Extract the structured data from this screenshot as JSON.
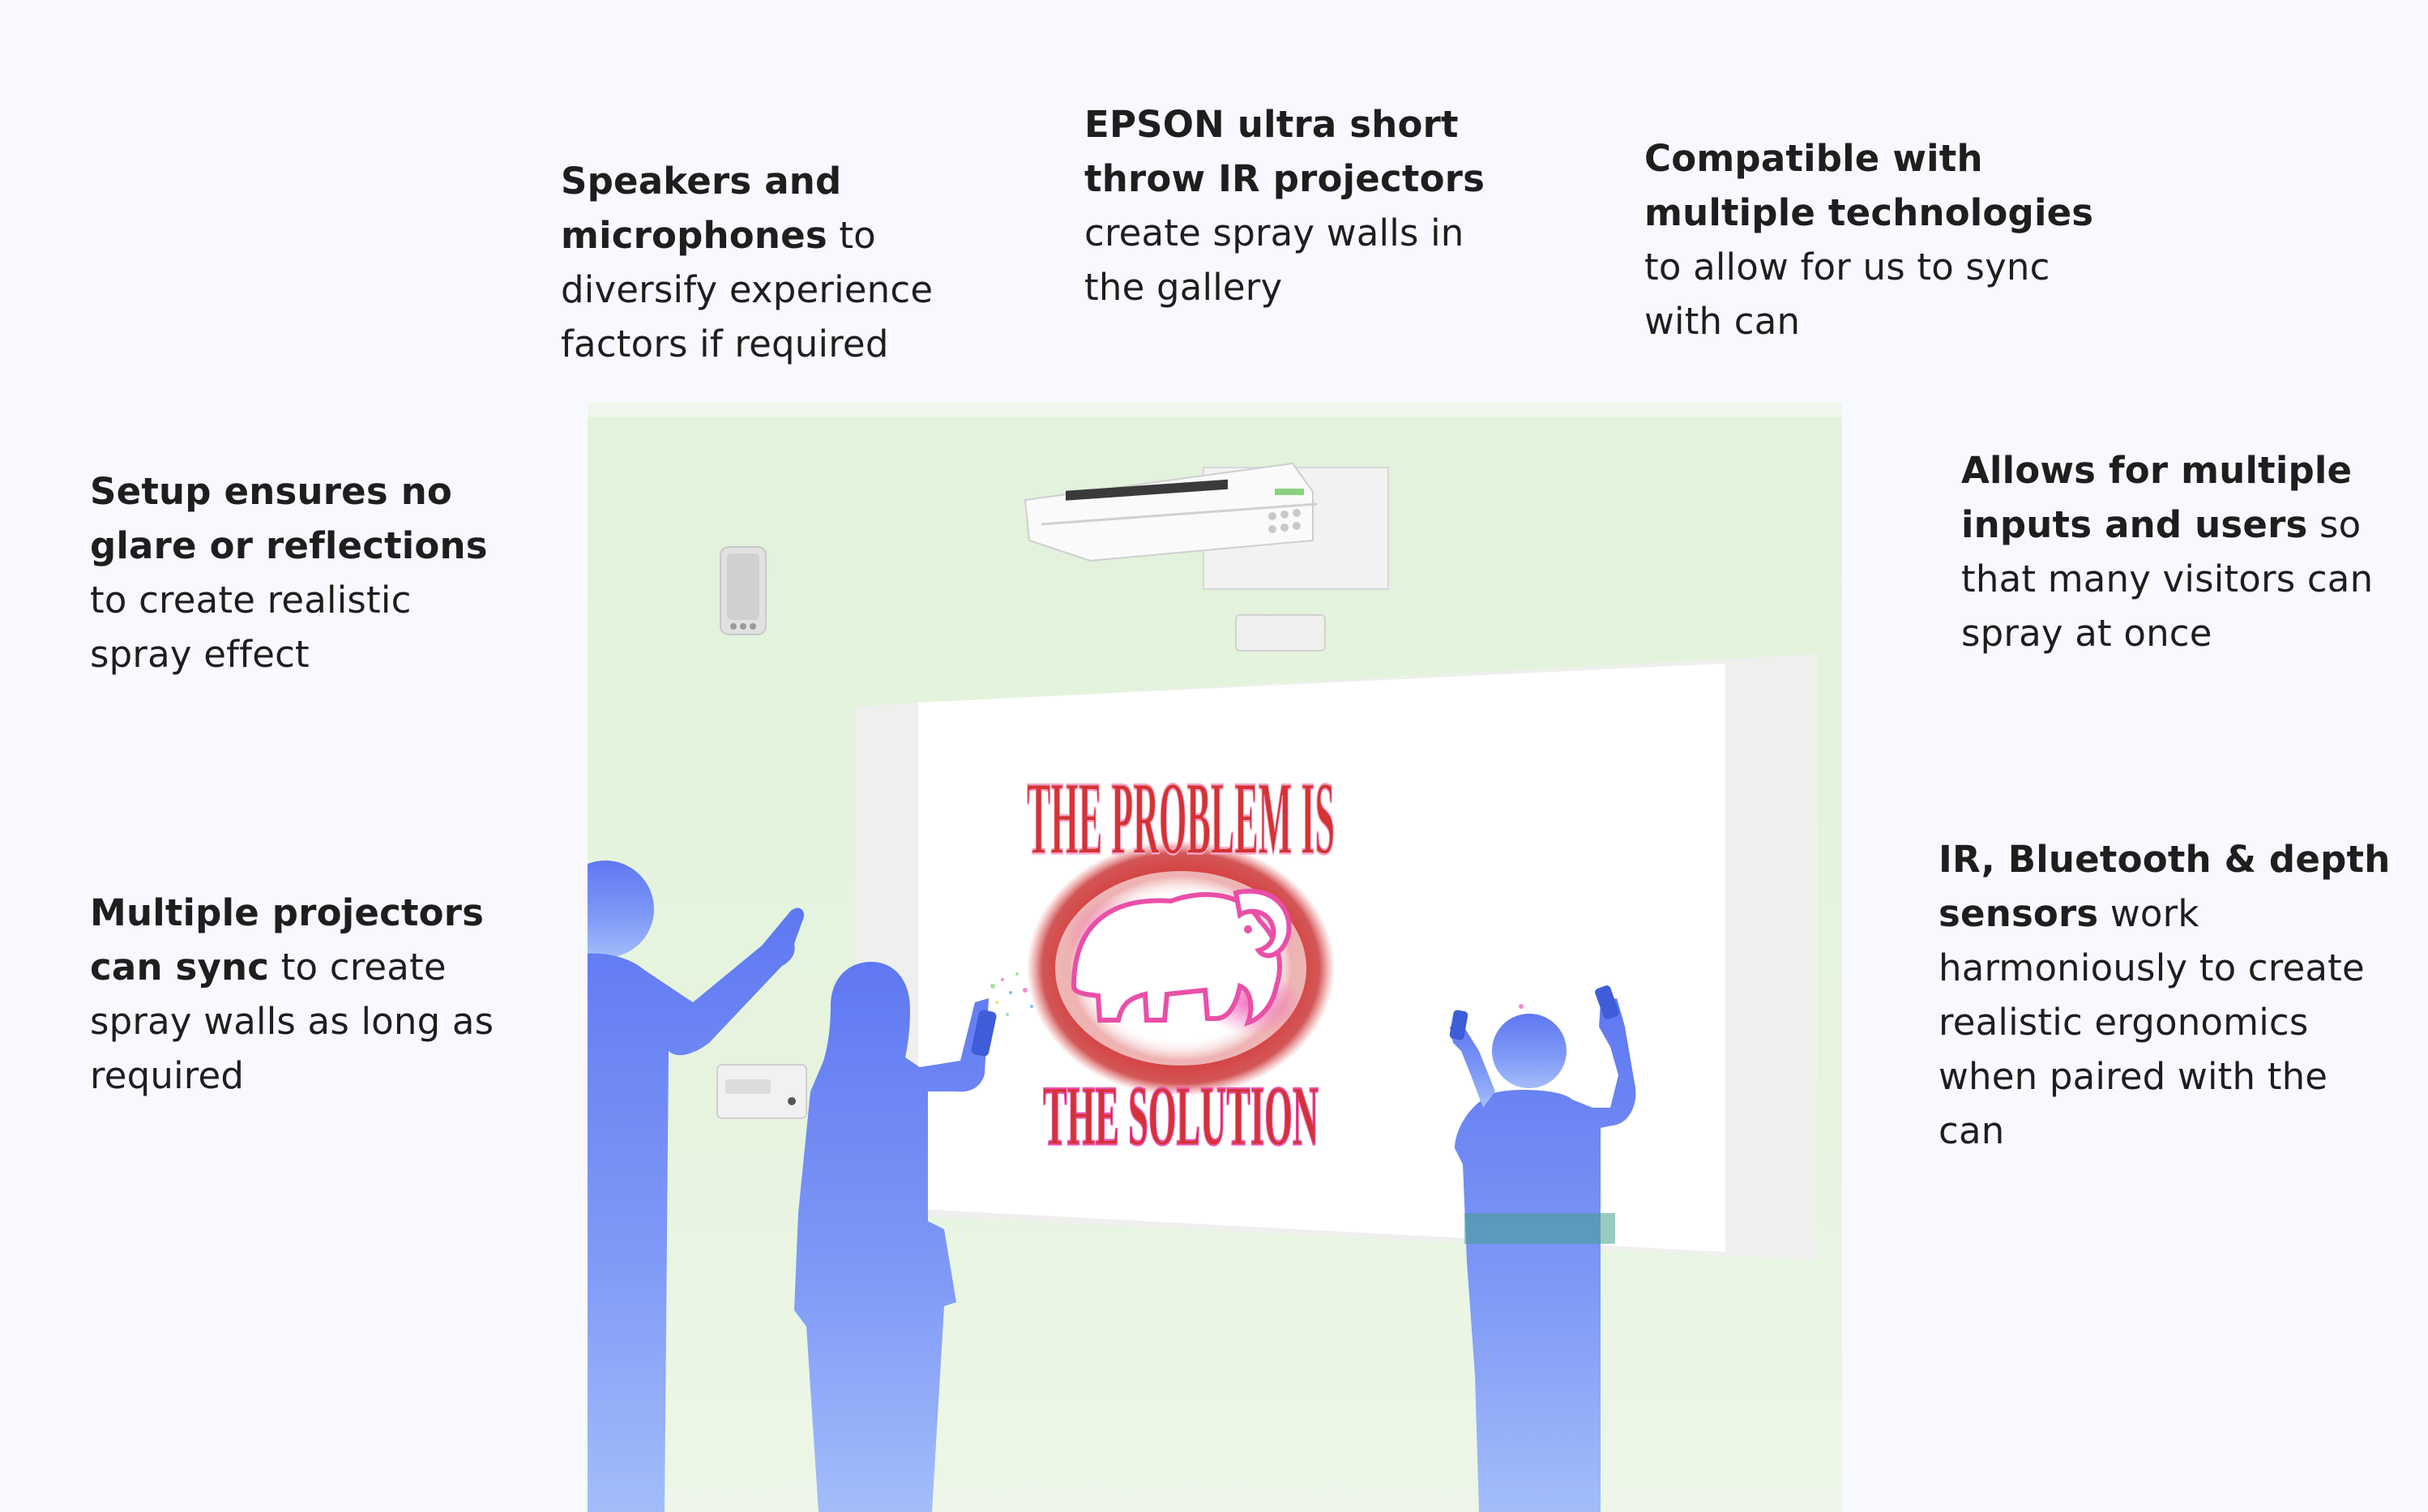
{
  "captions": {
    "speakers": {
      "bold": "Speakers and microphones",
      "rest": " to diversify experience factors if required"
    },
    "epson": {
      "bold": "EPSON ultra short throw IR projectors",
      "rest": " create spray walls in the gallery"
    },
    "compatible": {
      "bold": "Compatible with multiple technologies",
      "rest": " to allow for us to sync with can"
    },
    "glare": {
      "bold": "Setup ensures no glare or reflections",
      "rest": " to create realistic spray effect"
    },
    "inputs": {
      "bold": "Allows for multiple inputs and users",
      "rest": " so that many visitors can spray at once"
    },
    "sync": {
      "bold": "Multiple projectors can sync",
      "rest": " to create spray walls as long as required"
    },
    "sensors": {
      "bold": "IR, Bluetooth & depth sensors",
      "rest": " work harmoniously to create realistic ergonomics when paired with the can"
    }
  },
  "artwork": {
    "top_text": "THE PROBLEM IS",
    "bottom_text": "THE SOLUTION"
  },
  "colors": {
    "page_background": "#f8f9ff",
    "wall_green": "#e4f3dd",
    "silhouette_blue": "#6f8cf5",
    "poster_red": "#d63434",
    "poster_pink": "#ee4fb0"
  }
}
